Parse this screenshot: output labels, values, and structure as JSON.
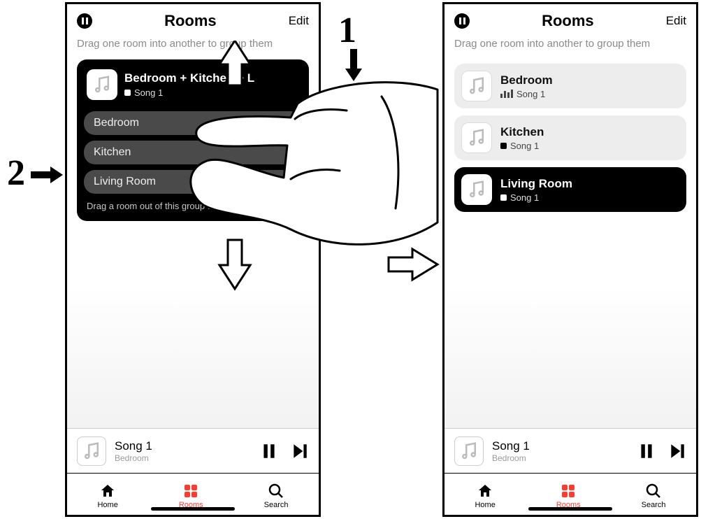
{
  "annotations": {
    "step1": "1",
    "step2": "2"
  },
  "left": {
    "header": {
      "title": "Rooms",
      "edit": "Edit"
    },
    "hint": "Drag one room into another to group them",
    "group": {
      "title": "Bedroom + Kitchen + L",
      "song": "Song 1",
      "rooms": [
        "Bedroom",
        "Kitchen",
        "Living Room"
      ],
      "ungroup_hint": "Drag a room out of this group to ungroup it"
    },
    "nowplaying": {
      "title": "Song 1",
      "room": "Bedroom"
    },
    "tabs": {
      "home": "Home",
      "rooms": "Rooms",
      "search": "Search"
    }
  },
  "right": {
    "header": {
      "title": "Rooms",
      "edit": "Edit"
    },
    "hint": "Drag one room into another to group them",
    "rooms": [
      {
        "name": "Bedroom",
        "song": "Song 1",
        "icon": "eq",
        "style": "light"
      },
      {
        "name": "Kitchen",
        "song": "Song 1",
        "icon": "stop",
        "style": "light"
      },
      {
        "name": "Living Room",
        "song": "Song 1",
        "icon": "stop",
        "style": "dark"
      }
    ],
    "nowplaying": {
      "title": "Song 1",
      "room": "Bedroom"
    },
    "tabs": {
      "home": "Home",
      "rooms": "Rooms",
      "search": "Search"
    }
  }
}
